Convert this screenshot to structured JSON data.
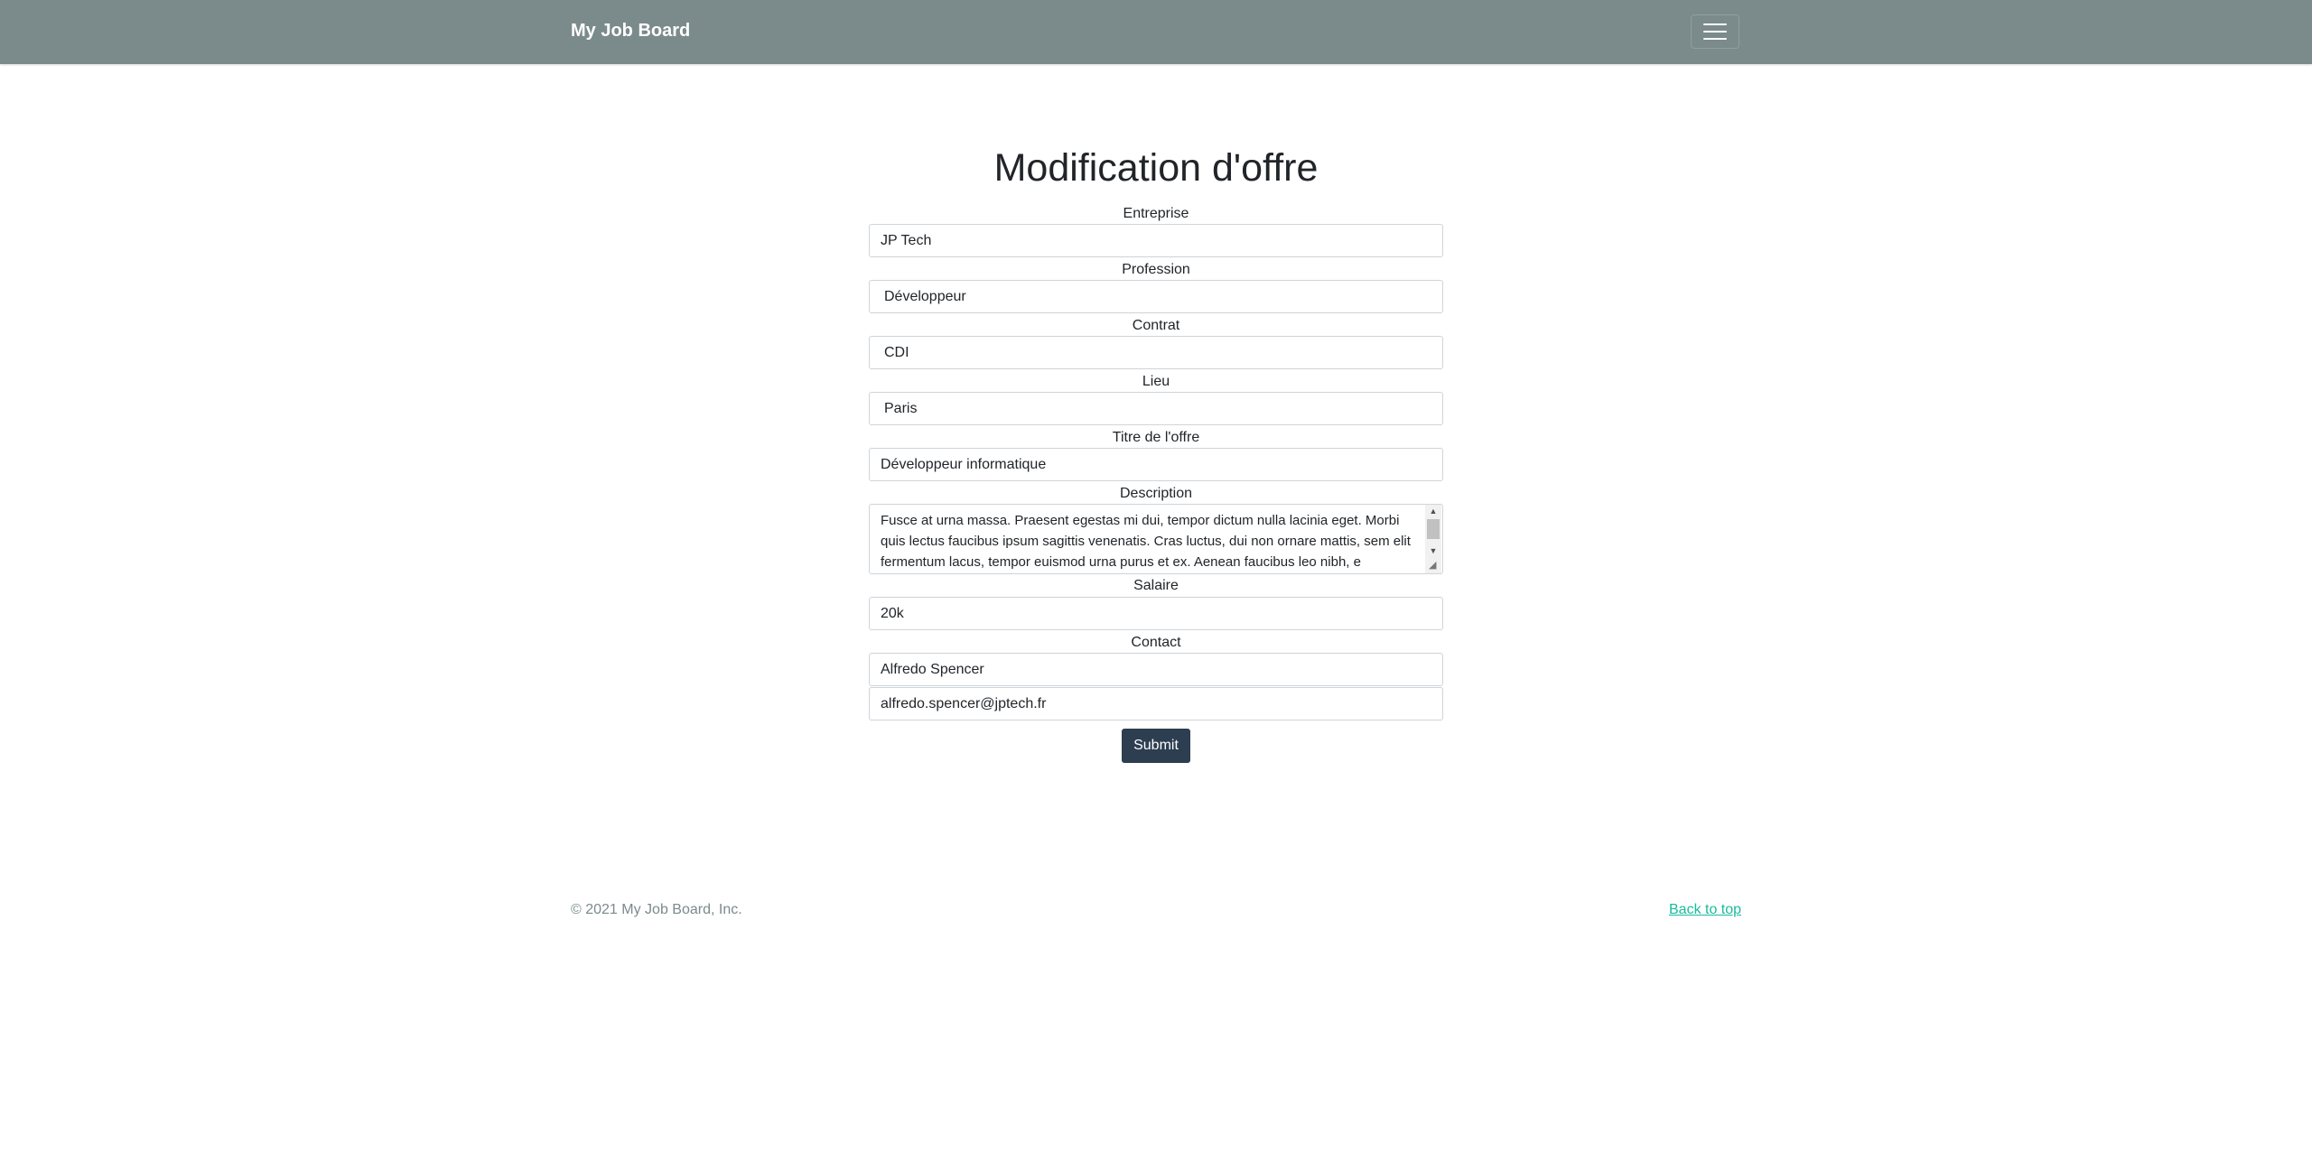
{
  "navbar": {
    "brand": "My Job Board",
    "menu_icon": "hamburger-menu-icon"
  },
  "page": {
    "title": "Modification d'offre"
  },
  "form": {
    "entreprise": {
      "label": "Entreprise",
      "value": "JP Tech"
    },
    "profession": {
      "label": "Profession",
      "value": "Développeur"
    },
    "contrat": {
      "label": "Contrat",
      "value": "CDI"
    },
    "lieu": {
      "label": "Lieu",
      "value": "Paris"
    },
    "titre": {
      "label": "Titre de l'offre",
      "value": "Développeur informatique"
    },
    "description": {
      "label": "Description",
      "value": "Fusce at urna massa. Praesent egestas mi dui, tempor dictum nulla lacinia eget. Morbi quis lectus faucibus ipsum sagittis venenatis. Cras luctus, dui non ornare mattis, sem elit fermentum lacus, tempor euismod urna purus et ex. Aenean faucibus leo nibh, e"
    },
    "salaire": {
      "label": "Salaire",
      "value": "20k"
    },
    "contact": {
      "label": "Contact",
      "name": "Alfredo Spencer",
      "email": "alfredo.spencer@jptech.fr"
    },
    "submit_label": "Submit"
  },
  "footer": {
    "copyright": "© 2021 My Job Board, Inc.",
    "back_to_top": "Back to top"
  },
  "colors": {
    "navbar_bg": "#7b8a8b",
    "submit_bg": "#2c3e50",
    "link": "#18bc9c"
  }
}
